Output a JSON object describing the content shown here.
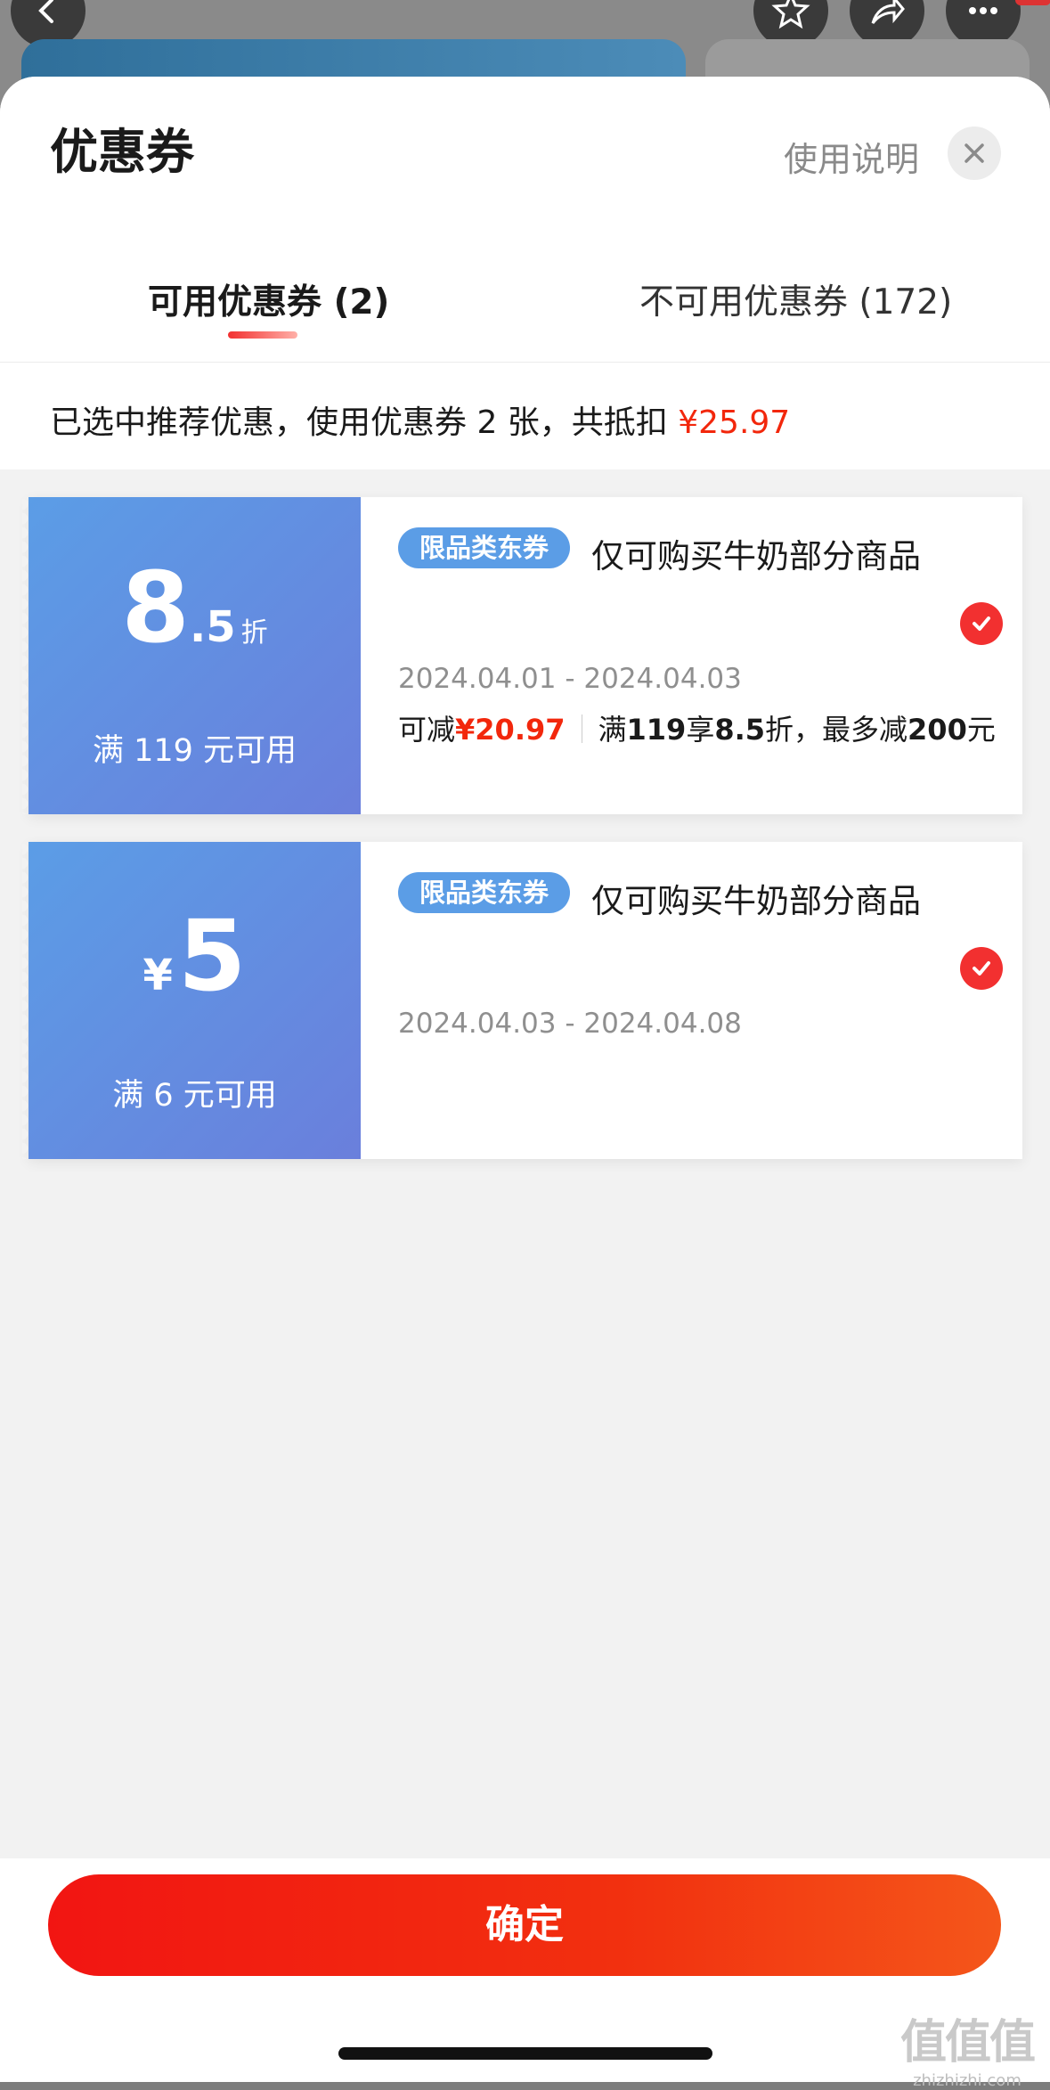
{
  "sheet": {
    "title": "优惠券",
    "help_label": "使用说明",
    "close_icon": "close-icon"
  },
  "tabs": [
    {
      "label": "可用优惠券 (2)",
      "active": true
    },
    {
      "label": "不可用优惠券 (172)",
      "active": false
    }
  ],
  "summary": {
    "text": "已选中推荐优惠，使用优惠券 2 张，共抵扣 ",
    "amount": "¥25.97"
  },
  "coupons": [
    {
      "value_main": "8",
      "value_sub": ".5",
      "value_unit": "折",
      "condition": "满 119 元可用",
      "tag": "限品类东券",
      "scope": "仅可购买牛奶部分商品",
      "dates": "2024.04.01 - 2024.04.03",
      "saving_prefix": "可减",
      "saving_amount": "¥20.97",
      "rule_a": "满",
      "rule_b": "119",
      "rule_c": "享",
      "rule_d": "8.5",
      "rule_e": "折，最多减",
      "rule_f": "200",
      "rule_g": "元",
      "selected": true
    },
    {
      "value_currency": "¥",
      "value_main": "5",
      "condition": "满 6 元可用",
      "tag": "限品类东券",
      "scope": "仅可购买牛奶部分商品",
      "dates": "2024.04.03 - 2024.04.08",
      "selected": true
    }
  ],
  "footer": {
    "confirm_label": "确定"
  },
  "watermark": {
    "mark": "值值值",
    "url": "zhizhizhi.com"
  },
  "colors": {
    "accent_red": "#f2270c",
    "coupon_blue": "#5b9de6"
  }
}
